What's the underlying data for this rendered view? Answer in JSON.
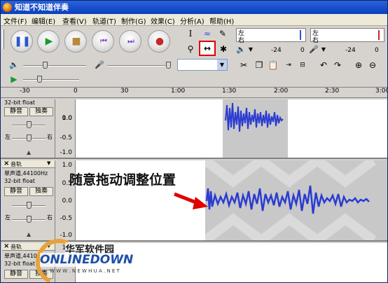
{
  "window": {
    "title": "知道不知道伴奏"
  },
  "menu": [
    "文件(F)",
    "编辑(E)",
    "查看(V)",
    "轨道(T)",
    "制作(G)",
    "效果(C)",
    "分析(A)",
    "帮助(H)"
  ],
  "meter": {
    "left": "左",
    "right": "右",
    "ticks": [
      "-24",
      "0",
      "-24",
      "0"
    ]
  },
  "ruler": {
    "ticks": [
      "-30",
      "0",
      "30",
      "1:00",
      "1:30",
      "2:00",
      "2:30",
      "3:00"
    ]
  },
  "track1": {
    "info": "32-bit float",
    "mute": "静音",
    "solo": "独奏",
    "pan_left": "左",
    "pan_right": "右",
    "yticks": [
      "1.0",
      "0.0",
      "-0.5",
      "-1.0"
    ]
  },
  "track2": {
    "name": "音轨",
    "format": "单声道,44100Hz",
    "bits": "32-bit float",
    "mute": "静音",
    "solo": "独奏",
    "pan_left": "左",
    "pan_right": "右",
    "yticks": [
      "1.0",
      "0.5",
      "0.0",
      "-0.5",
      "-1.0"
    ]
  },
  "track3": {
    "name": "音轨",
    "format": "单声道,44100",
    "bits": "32-bit float",
    "mute": "静音",
    "solo": "独奏",
    "ytick": "1.0"
  },
  "annotation": {
    "caption": "随意拖动调整位置"
  },
  "watermark": {
    "brand": "华军软件园",
    "logo": "ONLINEDOWN",
    "url": "W W W . N E W H U A . N E T"
  },
  "colors": {
    "title": "#0b3fbf",
    "wave": "#2b3bd1",
    "highlight": "#e00000"
  }
}
